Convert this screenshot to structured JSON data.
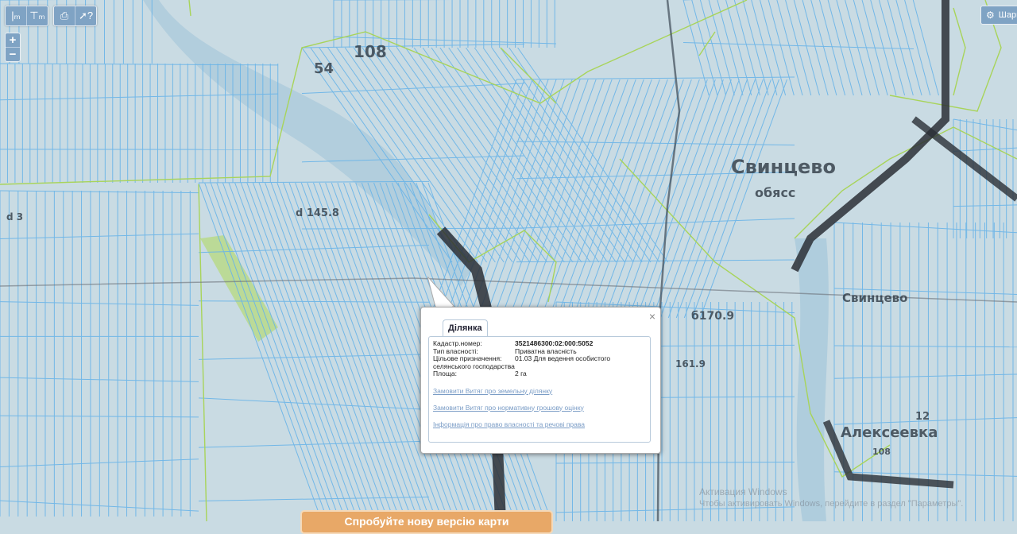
{
  "toolbar": {
    "buttons": [
      {
        "icon": "ruler-icon",
        "glyph": "|ₘ"
      },
      {
        "icon": "area-measure-icon",
        "glyph": "⊤ₘ"
      },
      {
        "icon": "printer-icon",
        "glyph": "⎙"
      },
      {
        "icon": "info-cursor-icon",
        "glyph": "➚?"
      }
    ]
  },
  "zoom": {
    "in": "+",
    "out": "−"
  },
  "share": {
    "label": "Шари",
    "icon": "gear-icon"
  },
  "map_labels": [
    {
      "text": "Свинцево",
      "size": 24
    },
    {
      "text": "обясс",
      "size": 16
    },
    {
      "text": "Свинцево",
      "size": 15
    },
    {
      "text": "Алексеевка",
      "size": 18
    },
    {
      "text": "108",
      "size": 20
    },
    {
      "text": "54",
      "size": 18
    },
    {
      "text": "б170.9",
      "size": 14
    },
    {
      "text": "d 145.8",
      "size": 13
    },
    {
      "text": "161.9",
      "size": 12
    },
    {
      "text": "12",
      "size": 13
    },
    {
      "text": "108",
      "size": 11
    },
    {
      "text": "d 3",
      "size": 12
    }
  ],
  "popup": {
    "close": "×",
    "tab": "Ділянка",
    "fields": [
      {
        "key": "Кадастр.номер:",
        "value": "3521486300:02:000:5052",
        "bold": true
      },
      {
        "key": "Тип власності:",
        "value": "Приватна власність",
        "bold": false
      },
      {
        "key": "Цільове призначення:",
        "value": "01.03 Для ведення особистого селянського господарства",
        "bold": false
      },
      {
        "key": "Площа:",
        "value": "2 га",
        "bold": false
      }
    ],
    "links": [
      "Замовити Витяг про земельну ділянку",
      "Замовити Витяг про нормативну грошову оцінку",
      "Інформація про право власності та речові права"
    ]
  },
  "watermark": {
    "line1": "Активация Windows",
    "line2": "Чтобы активировать Windows, перейдите в раздел \"Параметры\"."
  },
  "banner": {
    "label": "Спробуйте нову версію карти"
  },
  "colors": {
    "water": "#9fc3d8",
    "land": "#c9dbe3",
    "parcel_lines": "#69b4e8",
    "boundary": "#a8d45a",
    "road": "#2b2f36",
    "highlight": "#b8d98a"
  }
}
